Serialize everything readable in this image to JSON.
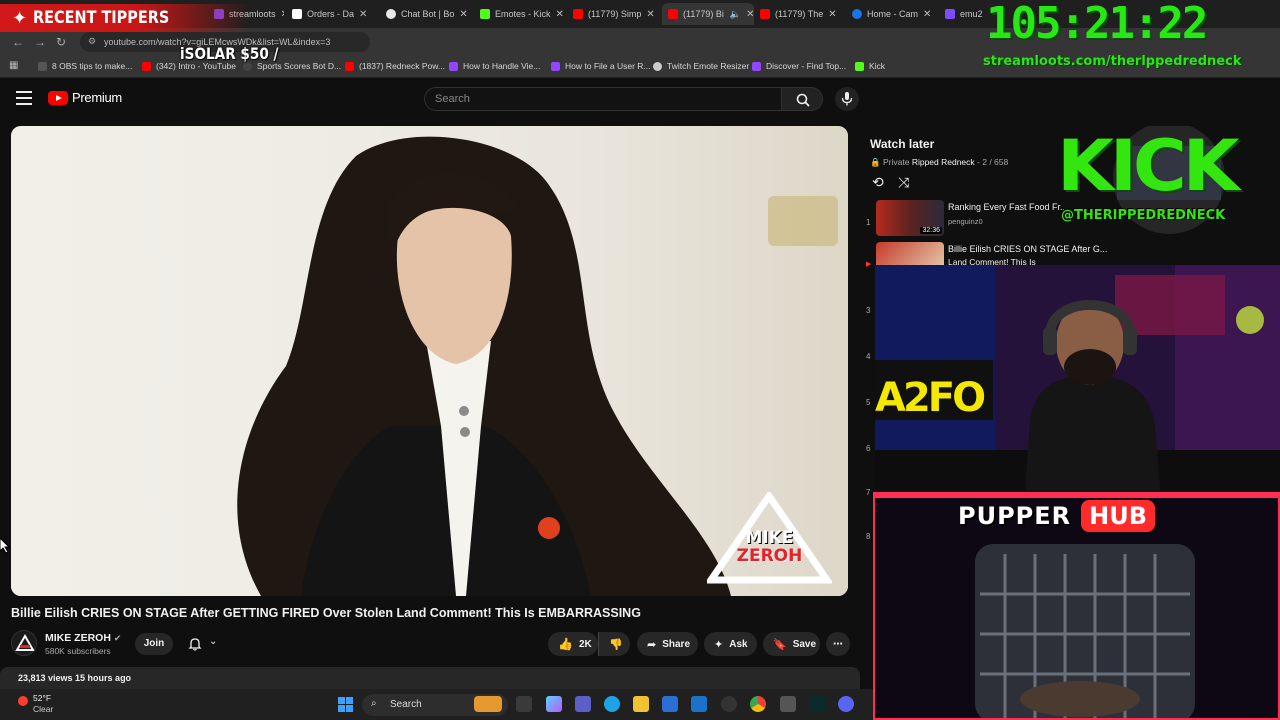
{
  "browser": {
    "tabs": [
      {
        "label": "streamloots",
        "color": "#7b4dff"
      },
      {
        "label": "Orders - Da",
        "color": "#ffffff"
      },
      {
        "label": "Chat Bot | Bo",
        "color": "#e8e8e8"
      },
      {
        "label": "Emotes - Kick",
        "color": "#53fc18"
      },
      {
        "label": "(11779) Simp",
        "color": "#ff0000"
      },
      {
        "label": "(11779) Bi",
        "color": "#ff0000"
      },
      {
        "label": "(11779) The",
        "color": "#ff0000"
      },
      {
        "label": "Home - Cam",
        "color": "#1a73e8"
      },
      {
        "label": "emu2",
        "color": "#7b4dff"
      }
    ],
    "url": "youtube.com/watch?v=giLEMcwsWDk&list=WL&index=3",
    "bookmarks": [
      {
        "label": "8 OBS tips to make...",
        "color": "#555555"
      },
      {
        "label": "(342) Intro - YouTube",
        "color": "#ff0000"
      },
      {
        "label": "Sports Scores Bot D...",
        "color": "#444444"
      },
      {
        "label": "(1837) Redneck Pow...",
        "color": "#ff0000"
      },
      {
        "label": "How to Handle Vie...",
        "color": "#9146ff"
      },
      {
        "label": "How to File a User R...",
        "color": "#9146ff"
      },
      {
        "label": "Twitch Emote Resizer",
        "color": "#cccccc"
      },
      {
        "label": "Discover - Find Top...",
        "color": "#9146ff"
      },
      {
        "label": "Kick",
        "color": "#53fc18"
      }
    ]
  },
  "overlay": {
    "tippers_title": "RECENT TIPPERS",
    "tipper_ticker": "iSOLAR $50 /",
    "timer": "105:21:22",
    "timer_url": "streamloots.com/therlppedredneck",
    "kick_word": "KICK",
    "kick_handle": "@THERIPPEDREDNECK",
    "pupper_word_a": "PUPPER",
    "pupper_word_b": "HUB"
  },
  "youtube": {
    "logo_text": "Premium",
    "search_placeholder": "Search",
    "video": {
      "title": "Billie Eilish CRIES ON STAGE After GETTING FIRED Over Stolen Land Comment! This Is EMBARRASSING",
      "watermark_line1": "MIKE",
      "watermark_line2": "ZEROH",
      "channel": "MIKE ZEROH",
      "subscribers": "580K subscribers",
      "join_label": "Join",
      "likes": "2K",
      "share_label": "Share",
      "ask_label": "Ask",
      "save_label": "Save",
      "views_time": "23,813 views  15 hours ago"
    },
    "playlist": {
      "title": "Watch later",
      "privacy": "Private",
      "owner": "Ripped Redneck",
      "position": "2 / 658",
      "items": [
        {
          "num": "1",
          "title": "Ranking Every Fast Food Fr...",
          "channel": "penguinz0",
          "duration": "32:36"
        },
        {
          "num": "▶",
          "title": "Billie Eilish CRIES ON STAGE After G...",
          "channel": "Land Comment! This Is EMBARRASSIN...",
          "duration": ""
        }
      ],
      "side_numbers": [
        "3",
        "4",
        "5",
        "6",
        "7",
        "8"
      ]
    }
  },
  "taskbar": {
    "weather_temp": "52°F",
    "weather_condition": "Clear",
    "search_label": "Search"
  }
}
